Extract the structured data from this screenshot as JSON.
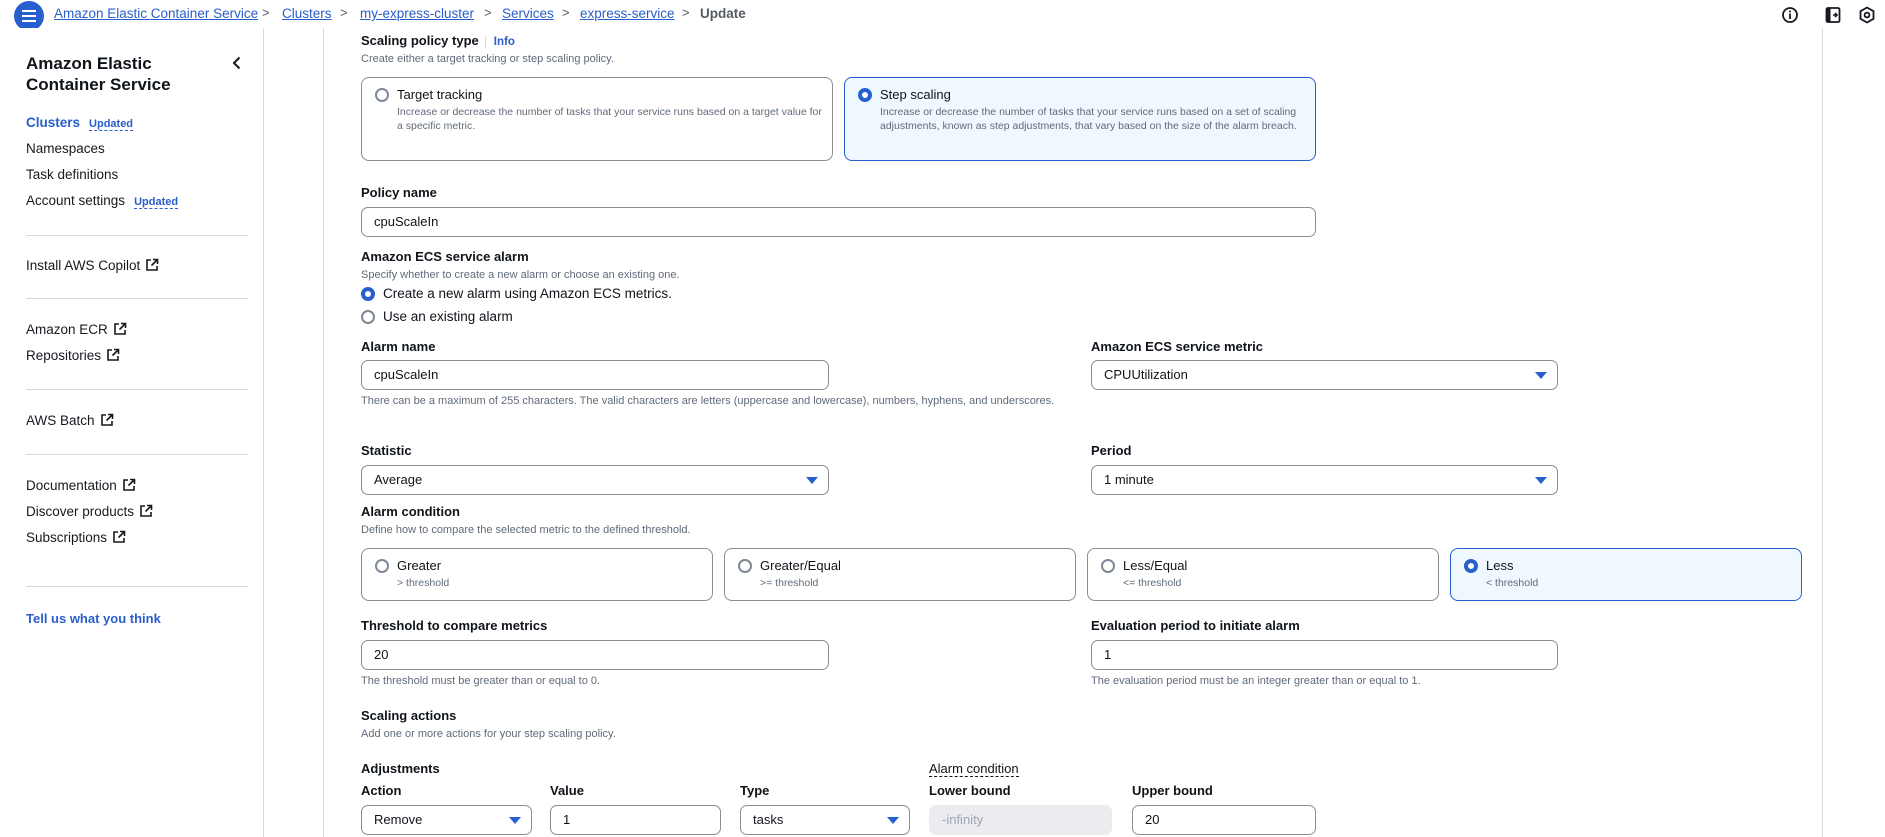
{
  "breadcrumbs": [
    "Amazon Elastic Container Service",
    "Clusters",
    "my-express-cluster",
    "Services",
    "express-service"
  ],
  "breadcrumb_current": "Update",
  "sidebar": {
    "title": "Amazon Elastic Container Service",
    "primary": [
      {
        "label": "Clusters",
        "badge": "Updated"
      },
      {
        "label": "Namespaces"
      },
      {
        "label": "Task definitions"
      },
      {
        "label": "Account settings",
        "badge": "Updated"
      }
    ],
    "copilot": "Install AWS Copilot",
    "ecr": [
      "Amazon ECR",
      "Repositories"
    ],
    "batch": "AWS Batch",
    "docs": [
      "Documentation",
      "Discover products",
      "Subscriptions"
    ],
    "feedback": "Tell us what you think"
  },
  "policy_type": {
    "label": "Scaling policy type",
    "info": "Info",
    "desc": "Create either a target tracking or step scaling policy.",
    "options": [
      {
        "title": "Target tracking",
        "desc": "Increase or decrease the number of tasks that your service runs based on a target value for a specific metric."
      },
      {
        "title": "Step scaling",
        "desc": "Increase or decrease the number of tasks that your service runs based on a set of scaling adjustments, known as step adjustments, that vary based on the size of the alarm breach."
      }
    ],
    "selected": "Step scaling"
  },
  "policy_name": {
    "label": "Policy name",
    "value": "cpuScaleIn"
  },
  "service_alarm": {
    "label": "Amazon ECS service alarm",
    "desc": "Specify whether to create a new alarm or choose an existing one.",
    "options": [
      "Create a new alarm using Amazon ECS metrics.",
      "Use an existing alarm"
    ],
    "selected": "Create a new alarm using Amazon ECS metrics."
  },
  "alarm_name": {
    "label": "Alarm name",
    "value": "cpuScaleIn",
    "hint": "There can be a maximum of 255 characters. The valid characters are letters (uppercase and lowercase), numbers, hyphens, and underscores."
  },
  "service_metric": {
    "label": "Amazon ECS service metric",
    "value": "CPUUtilization"
  },
  "statistic": {
    "label": "Statistic",
    "value": "Average"
  },
  "period": {
    "label": "Period",
    "value": "1 minute"
  },
  "alarm_condition": {
    "label": "Alarm condition",
    "desc": "Define how to compare the selected metric to the defined threshold.",
    "options": [
      {
        "title": "Greater",
        "sub": "> threshold"
      },
      {
        "title": "Greater/Equal",
        "sub": ">= threshold"
      },
      {
        "title": "Less/Equal",
        "sub": "<= threshold"
      },
      {
        "title": "Less",
        "sub": "< threshold"
      }
    ],
    "selected": "Less"
  },
  "threshold": {
    "label": "Threshold to compare metrics",
    "value": "20",
    "hint": "The threshold must be greater than or equal to 0."
  },
  "evaluation": {
    "label": "Evaluation period to initiate alarm",
    "value": "1",
    "hint": "The evaluation period must be an integer greater than or equal to 1."
  },
  "scaling_actions": {
    "label": "Scaling actions",
    "desc": "Add one or more actions for your step scaling policy.",
    "adjustments_label": "Adjustments",
    "alarm_condition_label": "Alarm condition",
    "columns": {
      "action": "Action",
      "value": "Value",
      "type": "Type",
      "lower": "Lower bound",
      "upper": "Upper bound"
    },
    "row": {
      "action": "Remove",
      "value": "1",
      "type": "tasks",
      "lower": "-infinity",
      "upper": "20"
    }
  }
}
